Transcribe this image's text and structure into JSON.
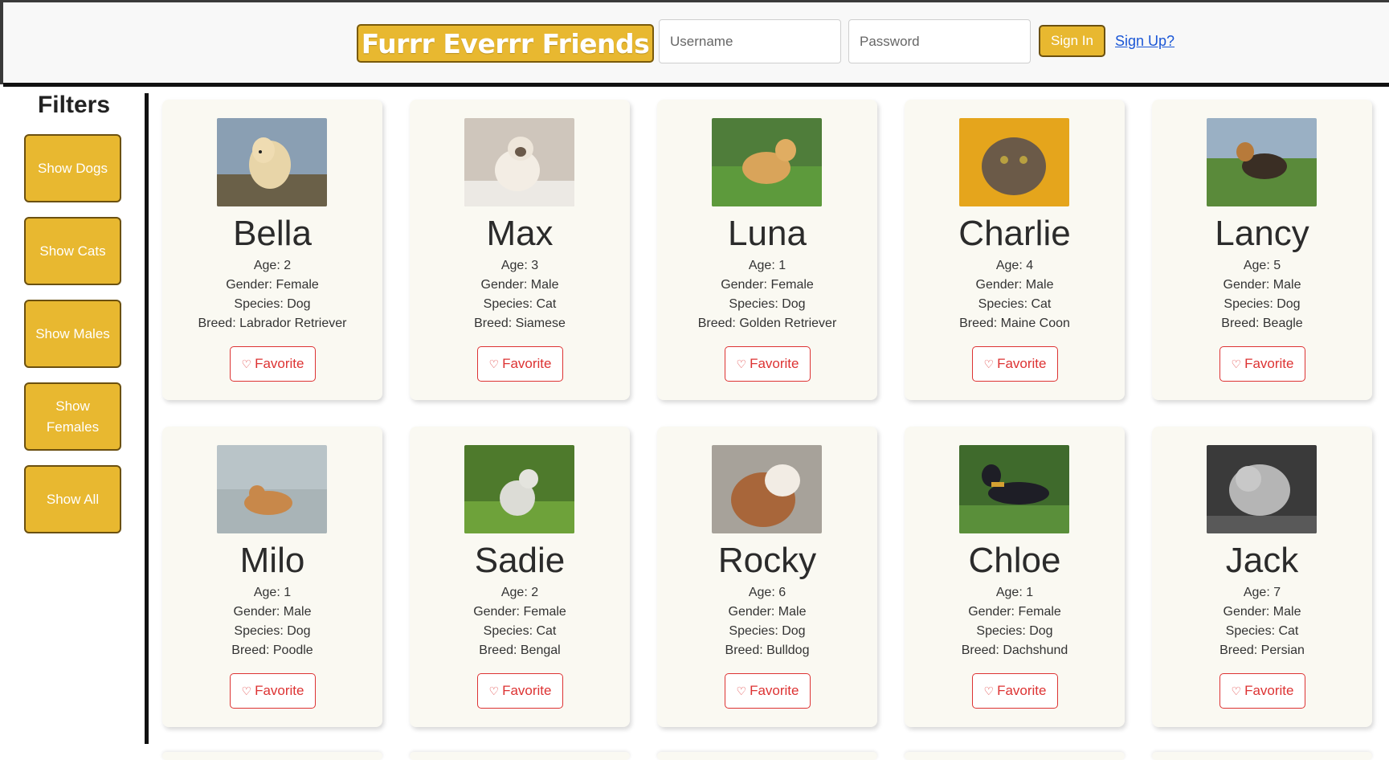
{
  "header": {
    "logo": "Furrr Everrr Friends",
    "username_placeholder": "Username",
    "password_placeholder": "Password",
    "signin_label": "Sign In",
    "signup_label": "Sign Up?"
  },
  "sidebar": {
    "title": "Filters",
    "buttons": [
      "Show Dogs",
      "Show Cats",
      "Show Males",
      "Show Females",
      "Show All"
    ]
  },
  "favorite_label": "Favorite",
  "pets": [
    {
      "name": "Bella",
      "age": "Age: 2",
      "gender": "Gender: Female",
      "species": "Species: Dog",
      "breed": "Breed: Labrador Retriever"
    },
    {
      "name": "Max",
      "age": "Age: 3",
      "gender": "Gender: Male",
      "species": "Species: Cat",
      "breed": "Breed: Siamese"
    },
    {
      "name": "Luna",
      "age": "Age: 1",
      "gender": "Gender: Female",
      "species": "Species: Dog",
      "breed": "Breed: Golden Retriever"
    },
    {
      "name": "Charlie",
      "age": "Age: 4",
      "gender": "Gender: Male",
      "species": "Species: Cat",
      "breed": "Breed: Maine Coon"
    },
    {
      "name": "Lancy",
      "age": "Age: 5",
      "gender": "Gender: Male",
      "species": "Species: Dog",
      "breed": "Breed: Beagle"
    },
    {
      "name": "Milo",
      "age": "Age: 1",
      "gender": "Gender: Male",
      "species": "Species: Dog",
      "breed": "Breed: Poodle"
    },
    {
      "name": "Sadie",
      "age": "Age: 2",
      "gender": "Gender: Female",
      "species": "Species: Cat",
      "breed": "Breed: Bengal"
    },
    {
      "name": "Rocky",
      "age": "Age: 6",
      "gender": "Gender: Male",
      "species": "Species: Dog",
      "breed": "Breed: Bulldog"
    },
    {
      "name": "Chloe",
      "age": "Age: 1",
      "gender": "Gender: Female",
      "species": "Species: Dog",
      "breed": "Breed: Dachshund"
    },
    {
      "name": "Jack",
      "age": "Age: 7",
      "gender": "Gender: Male",
      "species": "Species: Cat",
      "breed": "Breed: Persian"
    }
  ],
  "colors": {
    "accent": "#e8b830",
    "favorite": "#dd3333",
    "card_bg": "#faf9f2"
  }
}
